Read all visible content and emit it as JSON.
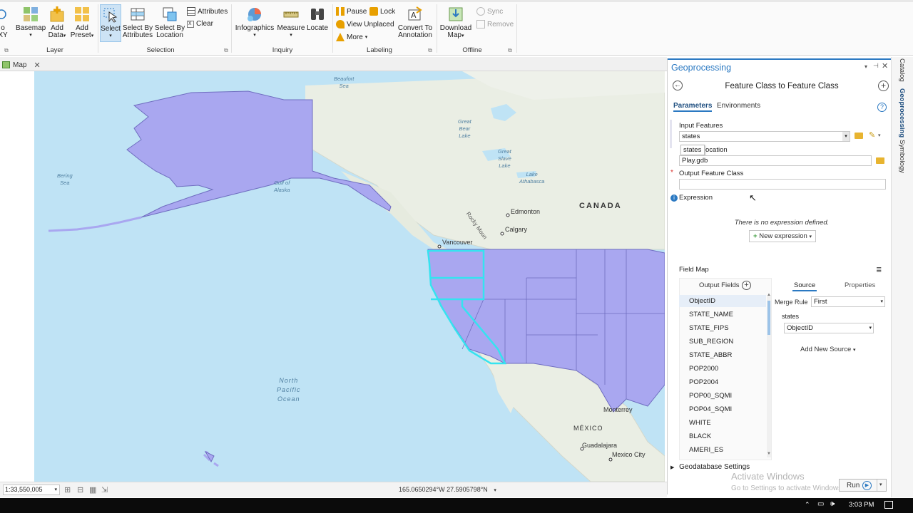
{
  "ribbon": {
    "xy_label_top": "o",
    "xy_label_bottom": "XY",
    "buttons": {
      "basemap": "Basemap",
      "add_data": "Add",
      "add_data_2": "Data",
      "add_preset": "Add",
      "add_preset_2": "Preset",
      "select": "Select",
      "select_by_attributes": "Select By",
      "select_by_attributes_2": "Attributes",
      "select_by_location": "Select By",
      "select_by_location_2": "Location",
      "attributes": "Attributes",
      "clear": "Clear",
      "infographics": "Infographics",
      "measure": "Measure",
      "locate": "Locate",
      "pause": "Pause",
      "lock": "Lock",
      "view_unplaced": "View Unplaced",
      "more": "More",
      "convert_to_annotation": "Convert To",
      "convert_to_annotation_2": "Annotation",
      "download_map": "Download",
      "download_map_2": "Map",
      "sync": "Sync",
      "remove": "Remove"
    },
    "groups": {
      "layer": "Layer",
      "selection": "Selection",
      "inquiry": "Inquiry",
      "labeling": "Labeling",
      "offline": "Offline"
    }
  },
  "map_tab": {
    "label": "Map"
  },
  "map": {
    "labels": {
      "beaufort": "Beaufort",
      "beaufort_2": "Sea",
      "bering": "Bering",
      "bering_2": "Sea",
      "gulf": "Gulf of",
      "gulf_2": "Alaska",
      "great_bear": "Great",
      "great_bear_2": "Bear",
      "great_bear_3": "Lake",
      "great_slave": "Great",
      "great_slave_2": "Slave",
      "great_slave_3": "Lake",
      "lake_athabasca": "Lake",
      "lake_athabasca_2": "Athabasca",
      "canada": "CANADA",
      "edmonton": "Edmonton",
      "calgary": "Calgary",
      "vancouver": "Vancouver",
      "rocky": "Rocky Moun",
      "north_pacific": "North",
      "north_pacific_2": "Pacific",
      "north_pacific_3": "Ocean",
      "mexico": "MÉXICO",
      "monterrey": "Monterrey",
      "guadalajara": "Guadalajara",
      "mexico_city": "Mexico City"
    }
  },
  "status": {
    "scale": "1:33,550,005",
    "coords": "165.0650294°W 27.5905798°N"
  },
  "geoprocessing": {
    "title": "Geoprocessing",
    "tool_title": "Feature Class to Feature Class",
    "tabs": {
      "parameters": "Parameters",
      "environments": "Environments"
    },
    "input_features_label": "Input Features",
    "input_features_value": "states",
    "autocomplete_item": "states",
    "output_location_label_tail": "ocation",
    "output_location_value": "Play.gdb",
    "output_feature_class_label": "Output Feature Class",
    "output_feature_class_value": "",
    "expression_label": "Expression",
    "no_expression": "There is no expression defined.",
    "new_expression": "New expression",
    "field_map_label": "Field Map",
    "output_fields_label": "Output Fields",
    "source_tab": "Source",
    "properties_tab": "Properties",
    "merge_rule_label": "Merge Rule",
    "merge_rule_value": "First",
    "source_layer": "states",
    "source_field_value": "ObjectID",
    "add_new_source": "Add New Source",
    "fields": [
      "ObjectID",
      "STATE_NAME",
      "STATE_FIPS",
      "SUB_REGION",
      "STATE_ABBR",
      "POP2000",
      "POP2004",
      "POP00_SQMI",
      "POP04_SQMI",
      "WHITE",
      "BLACK",
      "AMERI_ES"
    ],
    "geodatabase_settings": "Geodatabase Settings",
    "run": "Run"
  },
  "side_tabs": {
    "catalog": "Catalog",
    "geoprocessing": "Geoprocessing",
    "symbology": "Symbology"
  },
  "watermark": {
    "line1": "Activate Windows",
    "line2": "Go to Settings to activate Windows."
  },
  "taskbar": {
    "time": "3:03 PM"
  },
  "colors": {
    "accent": "#2b79c2",
    "states_fill": "#a9a7f0",
    "selection": "#35e3f0",
    "ocean": "#bfe3f5",
    "land": "#ecefe6"
  }
}
